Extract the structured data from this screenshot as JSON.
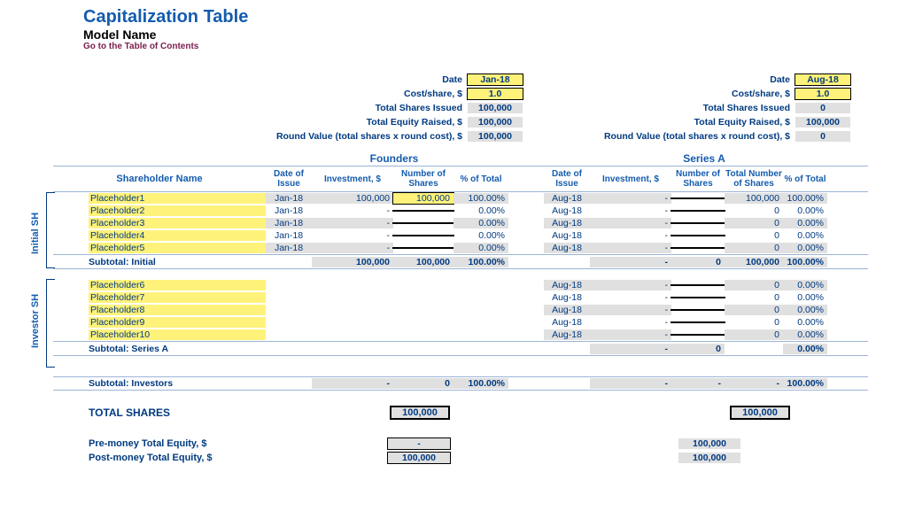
{
  "header": {
    "title": "Capitalization Table",
    "subtitle": "Model Name",
    "toc": "Go to the Table of Contents"
  },
  "labels": {
    "date": "Date",
    "cost": "Cost/share, $",
    "tsi": "Total Shares Issued",
    "ter": "Total Equity Raised, $",
    "rv": "Round Value (total shares x round cost), $",
    "shname": "Shareholder Name",
    "doi": "Date of Issue",
    "inv": "Investment, $",
    "nshares": "Number of Shares",
    "pct": "% of Total",
    "tns": "Total Number of Shares",
    "founders": "Founders",
    "seriesA": "Series A",
    "initialSH": "Initial SH",
    "investorSH": "Investor SH",
    "subInitial": "Subtotal: Initial",
    "subSeriesA": "Subtotal: Series A",
    "subInvestors": "Subtotal: Investors",
    "totalShares": "TOTAL SHARES",
    "preMoney": "Pre-money Total Equity, $",
    "postMoney": "Post-money Total Equity, $"
  },
  "founders_summary": {
    "date": "Jan-18",
    "cost": "1.0",
    "tsi": "100,000",
    "ter": "100,000",
    "rv": "100,000"
  },
  "seriesA_summary": {
    "date": "Aug-18",
    "cost": "1.0",
    "tsi": "0",
    "ter": "100,000",
    "rv": "0"
  },
  "initial": [
    {
      "name": "Placeholder1",
      "f": {
        "doi": "Jan-18",
        "inv": "100,000",
        "num": "100,000",
        "pct": "100.00%"
      },
      "a": {
        "doi": "Aug-18",
        "inv": "-",
        "num": "",
        "tot": "100,000",
        "pct": "100.00%"
      }
    },
    {
      "name": "Placeholder2",
      "f": {
        "doi": "Jan-18",
        "inv": "-",
        "num": "",
        "pct": "0.00%"
      },
      "a": {
        "doi": "Aug-18",
        "inv": "-",
        "num": "",
        "tot": "0",
        "pct": "0.00%"
      }
    },
    {
      "name": "Placeholder3",
      "f": {
        "doi": "Jan-18",
        "inv": "-",
        "num": "",
        "pct": "0.00%"
      },
      "a": {
        "doi": "Aug-18",
        "inv": "-",
        "num": "",
        "tot": "0",
        "pct": "0.00%"
      }
    },
    {
      "name": "Placeholder4",
      "f": {
        "doi": "Jan-18",
        "inv": "-",
        "num": "",
        "pct": "0.00%"
      },
      "a": {
        "doi": "Aug-18",
        "inv": "-",
        "num": "",
        "tot": "0",
        "pct": "0.00%"
      }
    },
    {
      "name": "Placeholder5",
      "f": {
        "doi": "Jan-18",
        "inv": "-",
        "num": "",
        "pct": "0.00%"
      },
      "a": {
        "doi": "Aug-18",
        "inv": "-",
        "num": "",
        "tot": "0",
        "pct": "0.00%"
      }
    }
  ],
  "subtotal_initial": {
    "f": {
      "inv": "100,000",
      "num": "100,000",
      "pct": "100.00%"
    },
    "a": {
      "inv": "-",
      "num": "0",
      "tot": "100,000",
      "pct": "100.00%"
    }
  },
  "investors": [
    {
      "name": "Placeholder6",
      "a": {
        "doi": "Aug-18",
        "inv": "-",
        "num": "",
        "tot": "0",
        "pct": "0.00%"
      }
    },
    {
      "name": "Placeholder7",
      "a": {
        "doi": "Aug-18",
        "inv": "-",
        "num": "",
        "tot": "0",
        "pct": "0.00%"
      }
    },
    {
      "name": "Placeholder8",
      "a": {
        "doi": "Aug-18",
        "inv": "-",
        "num": "",
        "tot": "0",
        "pct": "0.00%"
      }
    },
    {
      "name": "Placeholder9",
      "a": {
        "doi": "Aug-18",
        "inv": "-",
        "num": "",
        "tot": "0",
        "pct": "0.00%"
      }
    },
    {
      "name": "Placeholder10",
      "a": {
        "doi": "Aug-18",
        "inv": "-",
        "num": "",
        "tot": "0",
        "pct": "0.00%"
      }
    }
  ],
  "subtotal_seriesA": {
    "a": {
      "inv": "-",
      "num": "0",
      "tot": "",
      "pct": "0.00%"
    }
  },
  "subtotal_investors": {
    "f": {
      "inv": "-",
      "num": "0",
      "pct": "100.00%"
    },
    "a": {
      "inv": "-",
      "num": "-",
      "tot": "-",
      "pct": "100.00%"
    }
  },
  "total_shares": {
    "f": "100,000",
    "a": "100,000"
  },
  "equity": {
    "pre": {
      "f": "-",
      "a": "100,000"
    },
    "post": {
      "f": "100,000",
      "a": "100,000"
    }
  }
}
